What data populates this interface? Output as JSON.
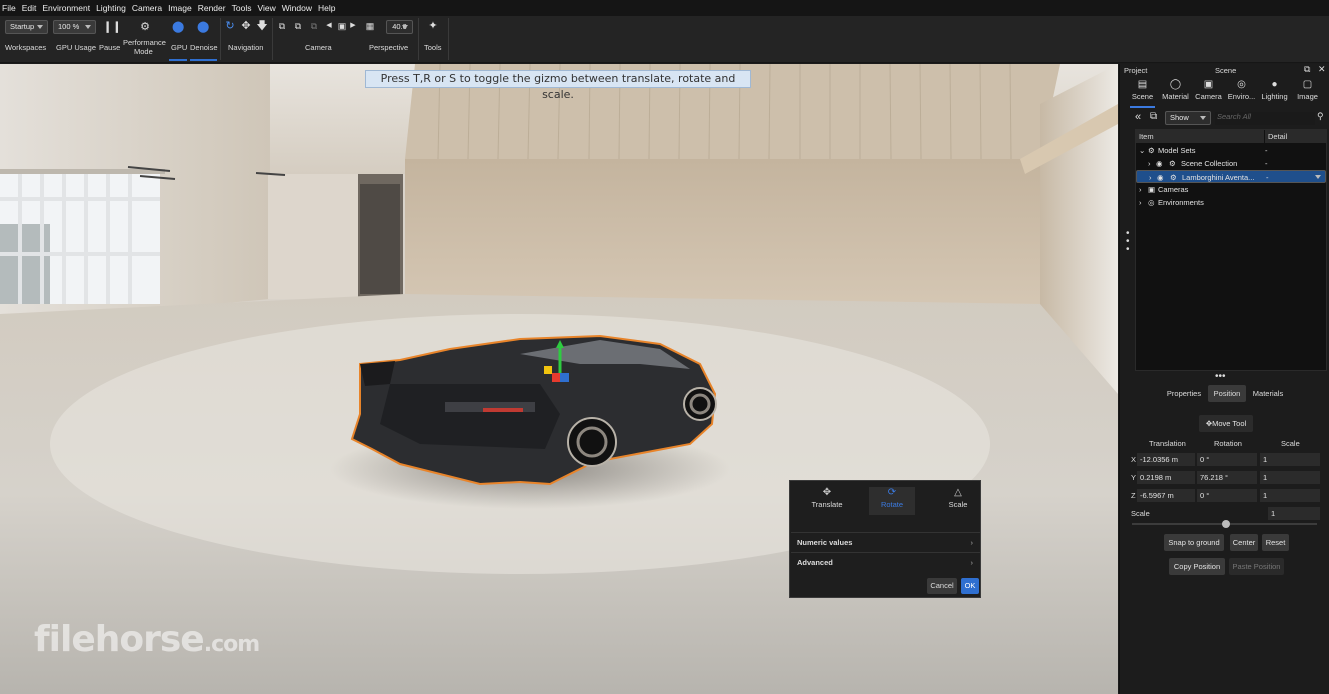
{
  "menu": [
    "File",
    "Edit",
    "Environment",
    "Lighting",
    "Camera",
    "Image",
    "Render",
    "Tools",
    "View",
    "Window",
    "Help"
  ],
  "toolbar": {
    "workspace_value": "Startup",
    "workspaces_label": "Workspaces",
    "zoom_value": "100 %",
    "gpu_usage_label": "GPU Usage",
    "pause_label": "Pause",
    "performance_mode_label_line1": "Performance",
    "performance_mode_label_line2": "Mode",
    "gpu_label": "GPU",
    "denoise_label": "Denoise",
    "navigation_label": "Navigation",
    "camera_label": "Camera",
    "fov_value": "40.0",
    "perspective_label": "Perspective",
    "tools_label": "Tools"
  },
  "viewport": {
    "hint": "Press T,R or S to toggle the gizmo between translate, rotate and scale.",
    "watermark_main": "filehorse",
    "watermark_suffix": ".com"
  },
  "gizmo_panel": {
    "modes": [
      {
        "label": "Translate",
        "icon": "translate-icon"
      },
      {
        "label": "Rotate",
        "icon": "rotate-icon"
      },
      {
        "label": "Scale",
        "icon": "scale-icon"
      }
    ],
    "active_mode": "Rotate",
    "numeric_values_label": "Numeric values",
    "advanced_label": "Advanced",
    "cancel_label": "Cancel",
    "ok_label": "OK"
  },
  "right_panel": {
    "project_label": "Project",
    "scene_label": "Scene",
    "tabs": [
      "Scene",
      "Material",
      "Camera",
      "Enviro...",
      "Lighting",
      "Image"
    ],
    "active_tab": "Scene",
    "filter_value": "Show",
    "search_placeholder": "Search All",
    "tree_headers": {
      "item": "Item",
      "detail": "Detail"
    },
    "tree": [
      {
        "label": "Model Sets",
        "detail": "-"
      },
      {
        "label": "Scene Collection",
        "detail": "-"
      },
      {
        "label": "Lamborghini Aventa...",
        "detail": "-"
      },
      {
        "label": "Cameras",
        "detail": ""
      },
      {
        "label": "Environments",
        "detail": ""
      }
    ],
    "prop_tabs": [
      "Properties",
      "Position",
      "Materials"
    ],
    "active_prop_tab": "Position",
    "move_tool_label": "Move Tool",
    "col_headers": {
      "translation": "Translation",
      "rotation": "Rotation",
      "scale": "Scale"
    },
    "rows": [
      {
        "axis": "X",
        "translation": "-12.0356 m",
        "rotation": "0 °",
        "scale": "1"
      },
      {
        "axis": "Y",
        "translation": "0.2198 m",
        "rotation": "76.218 °",
        "scale": "1"
      },
      {
        "axis": "Z",
        "translation": "-6.5967 m",
        "rotation": "0 °",
        "scale": "1"
      }
    ],
    "uniform_scale_label": "Scale",
    "uniform_scale_value": "1",
    "snap_to_ground_label": "Snap to ground",
    "center_label": "Center",
    "reset_label": "Reset",
    "copy_position_label": "Copy Position",
    "paste_position_label": "Paste Position"
  },
  "colors": {
    "accent": "#3b7ae0",
    "selection_outline": "#e8842a",
    "tree_selected": "#1f4f8c"
  }
}
